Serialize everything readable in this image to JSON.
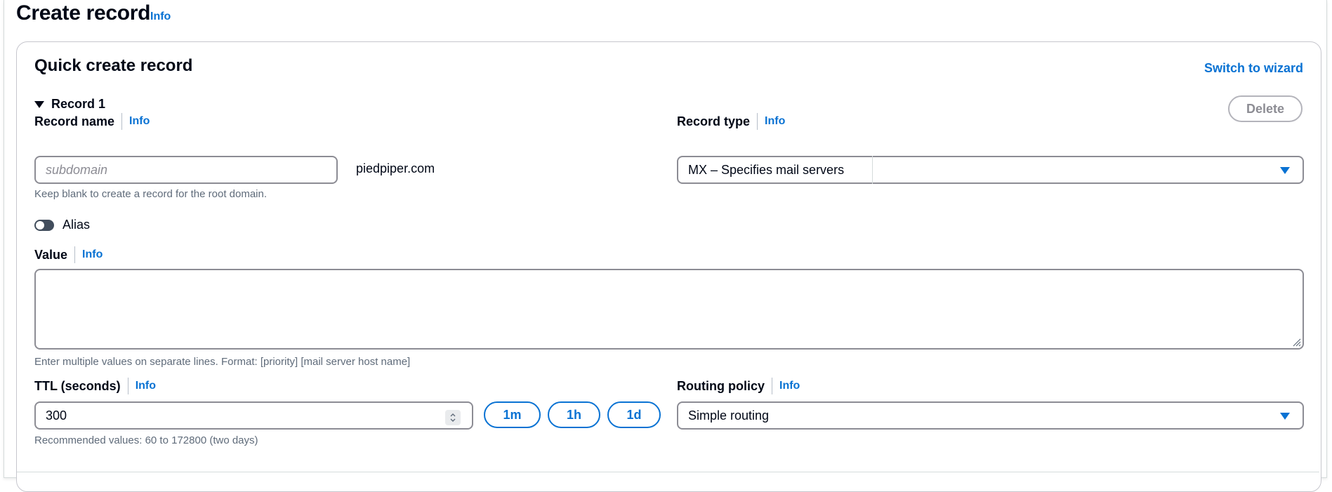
{
  "page": {
    "title": "Create record",
    "info": "Info"
  },
  "card": {
    "title": "Quick create record",
    "switch_wizard": "Switch to wizard",
    "record_section": "Record 1",
    "delete_label": "Delete"
  },
  "record_name": {
    "label": "Record name",
    "info": "Info",
    "placeholder": "subdomain",
    "value": "",
    "domain_suffix": "piedpiper.com",
    "hint": "Keep blank to create a record for the root domain."
  },
  "record_type": {
    "label": "Record type",
    "info": "Info",
    "selected": "MX – Specifies mail servers"
  },
  "alias": {
    "label": "Alias",
    "enabled": false
  },
  "value": {
    "label": "Value",
    "info": "Info",
    "text": "",
    "hint": "Enter multiple values on separate lines. Format: [priority] [mail server host name]"
  },
  "ttl": {
    "label": "TTL (seconds)",
    "info": "Info",
    "value": "300",
    "hint": "Recommended values: 60 to 172800 (two days)",
    "presets": [
      "1m",
      "1h",
      "1d"
    ]
  },
  "routing_policy": {
    "label": "Routing policy",
    "info": "Info",
    "selected": "Simple routing"
  },
  "colors": {
    "accent": "#0972d3",
    "text": "#000716",
    "border": "#8c8c94"
  }
}
